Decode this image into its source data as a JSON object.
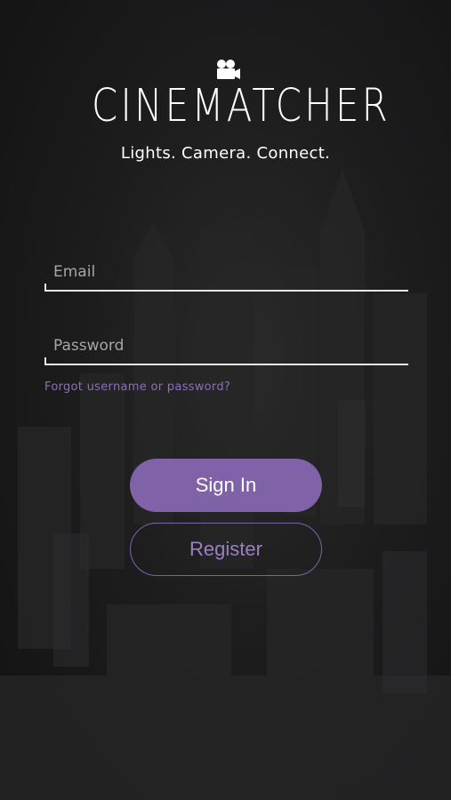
{
  "brand": {
    "logo_text": "CINEMATCHER",
    "tagline": "Lights. Camera. Connect."
  },
  "login": {
    "email_placeholder": "Email",
    "password_placeholder": "Password",
    "forgot_label": "Forgot username or password?",
    "signin_label": "Sign In",
    "register_label": "Register"
  },
  "colors": {
    "accent": "#7f62a8",
    "link": "#8c6fb8",
    "background": "#1d1d1e"
  },
  "icons": {
    "logo_mark": "film-camera-icon"
  }
}
